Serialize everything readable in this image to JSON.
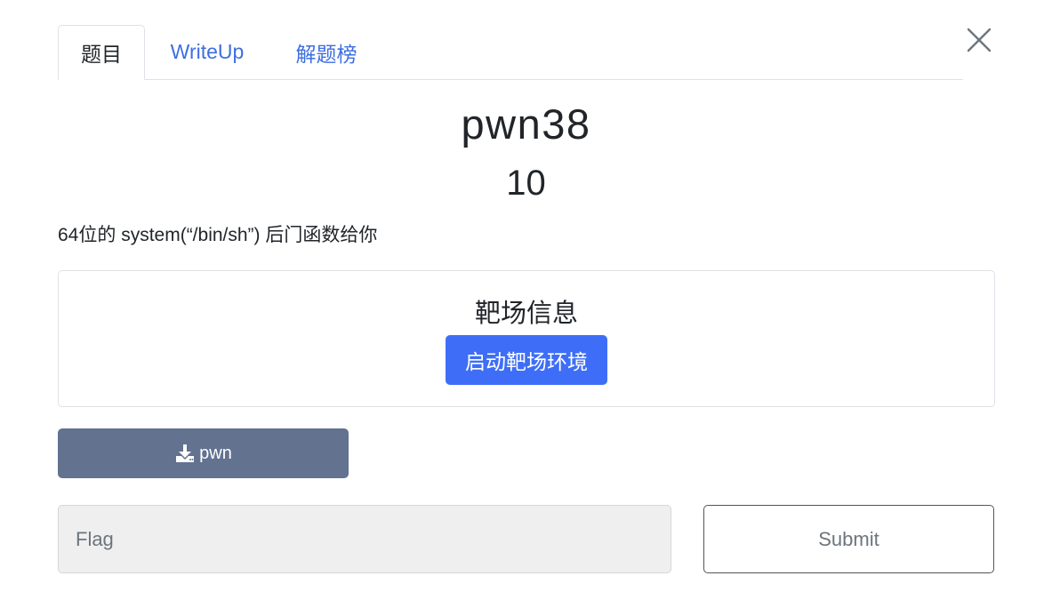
{
  "tabs": [
    {
      "label": "题目",
      "active": true
    },
    {
      "label": "WriteUp",
      "active": false
    },
    {
      "label": "解题榜",
      "active": false
    }
  ],
  "challenge": {
    "name": "pwn38",
    "value": "10",
    "description": "64位的 system(“/bin/sh”) 后门函数给你"
  },
  "environment": {
    "title": "靶场信息",
    "start_button_label": "启动靶场环境"
  },
  "download": {
    "icon": "download-icon",
    "file_label": "pwn"
  },
  "flag_form": {
    "placeholder": "Flag",
    "value": "",
    "submit_label": "Submit"
  },
  "colors": {
    "tab_link": "#3e6ee0",
    "primary_button": "#3e6ef8",
    "download_button": "#62728f"
  }
}
